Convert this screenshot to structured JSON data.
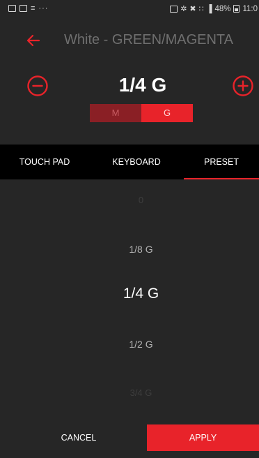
{
  "status_bar": {
    "left_overflow": "···",
    "right_text": "48%",
    "time": "11:0",
    "icons": [
      "gallery-icon",
      "mail-icon",
      "signal-bars-icon",
      "overflow-dots-icon",
      "alarm-icon",
      "bluetooth-icon",
      "mute-icon",
      "wifi-icon",
      "cell-signal-icon",
      "battery-icon"
    ]
  },
  "header": {
    "title": "White - GREEN/MAGENTA",
    "back_icon": "arrow-left-icon"
  },
  "value_control": {
    "current_value": "1/4 G",
    "minus_icon": "minus-circle-icon",
    "plus_icon": "plus-circle-icon",
    "toggle": {
      "m_label": "M",
      "g_label": "G",
      "selected": "G"
    }
  },
  "tabs": [
    {
      "label": "TOUCH PAD",
      "active": false
    },
    {
      "label": "KEYBOARD",
      "active": false
    },
    {
      "label": "PRESET",
      "active": true
    }
  ],
  "picker": {
    "items": [
      "0",
      "1/8 G",
      "1/4 G",
      "1/2 G",
      "3/4 G"
    ],
    "selected": "1/4 G"
  },
  "actions": {
    "cancel_label": "CANCEL",
    "apply_label": "APPLY"
  },
  "colors": {
    "accent": "#e8232a",
    "accent_dark": "#8a1f25",
    "background": "#262626",
    "tab_bar": "#000000",
    "title": "#6f6f6f"
  }
}
